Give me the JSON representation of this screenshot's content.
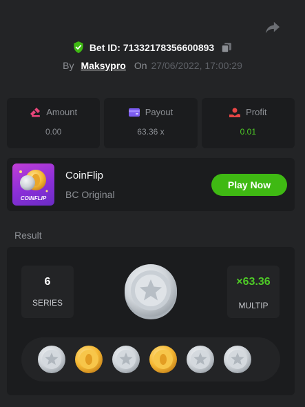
{
  "header": {
    "bet_id_label": "Bet ID: 71332178356600893",
    "by_label": "By",
    "username": "Maksypro",
    "on_label": "On",
    "datetime": "27/06/2022, 17:00:29",
    "icons": [
      "share-icon",
      "shield-check-icon",
      "copy-icon"
    ]
  },
  "stats": [
    {
      "label": "Amount",
      "value": "0.00",
      "icon": "coins-icon"
    },
    {
      "label": "Payout",
      "value": "63.36 x",
      "icon": "wallet-icon"
    },
    {
      "label": "Profit",
      "value": "0.01",
      "icon": "profit-icon"
    }
  ],
  "game": {
    "name": "CoinFlip",
    "subtitle": "BC Original",
    "thumb_text": "COINFLIP",
    "play_label": "Play Now"
  },
  "result": {
    "section_label": "Result",
    "series_value": "6",
    "series_caption": "SERIES",
    "multiplier_value": "×63.36",
    "multiplier_caption": "MULTIP",
    "coins": [
      "silver",
      "gold",
      "silver",
      "gold",
      "silver",
      "silver"
    ]
  },
  "colors": {
    "background": "#232426",
    "panel": "#1b1c1e",
    "accent_green": "#3fb913",
    "profit_green": "#4ecb26",
    "muted_text": "#8c8f94"
  }
}
